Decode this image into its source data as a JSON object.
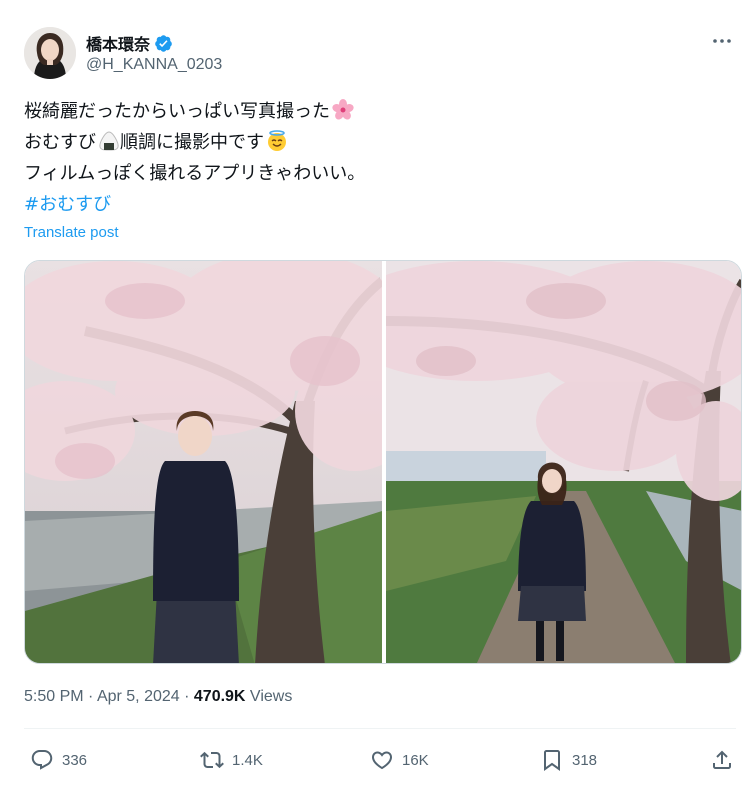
{
  "author": {
    "display_name": "橋本環奈",
    "handle": "@H_KANNA_0203",
    "verified_icon": "verified-badge-icon"
  },
  "tweet": {
    "lines": [
      "桜綺麗だったからいっぱい写真撮った",
      "おむすび",
      "順調に撮影中です",
      "フィルムっぽく撮れるアプリきゃわいい。"
    ],
    "hashtag": "#おむすび",
    "emojis": [
      "cherry-blossom-emoji",
      "rice-ball-emoji",
      "halo-smile-emoji"
    ]
  },
  "translate_label": "Translate post",
  "meta": {
    "time": "5:50 PM",
    "separator1": " · ",
    "date": "Apr 5, 2024",
    "separator2": " · ",
    "views_count": "470.9K",
    "views_label": " Views"
  },
  "actions": {
    "replies": "336",
    "reposts": "1.4K",
    "likes": "16K",
    "bookmarks": "318"
  },
  "colors": {
    "accent": "#1d9bf0",
    "text": "#0f1419",
    "secondary": "#536471"
  }
}
